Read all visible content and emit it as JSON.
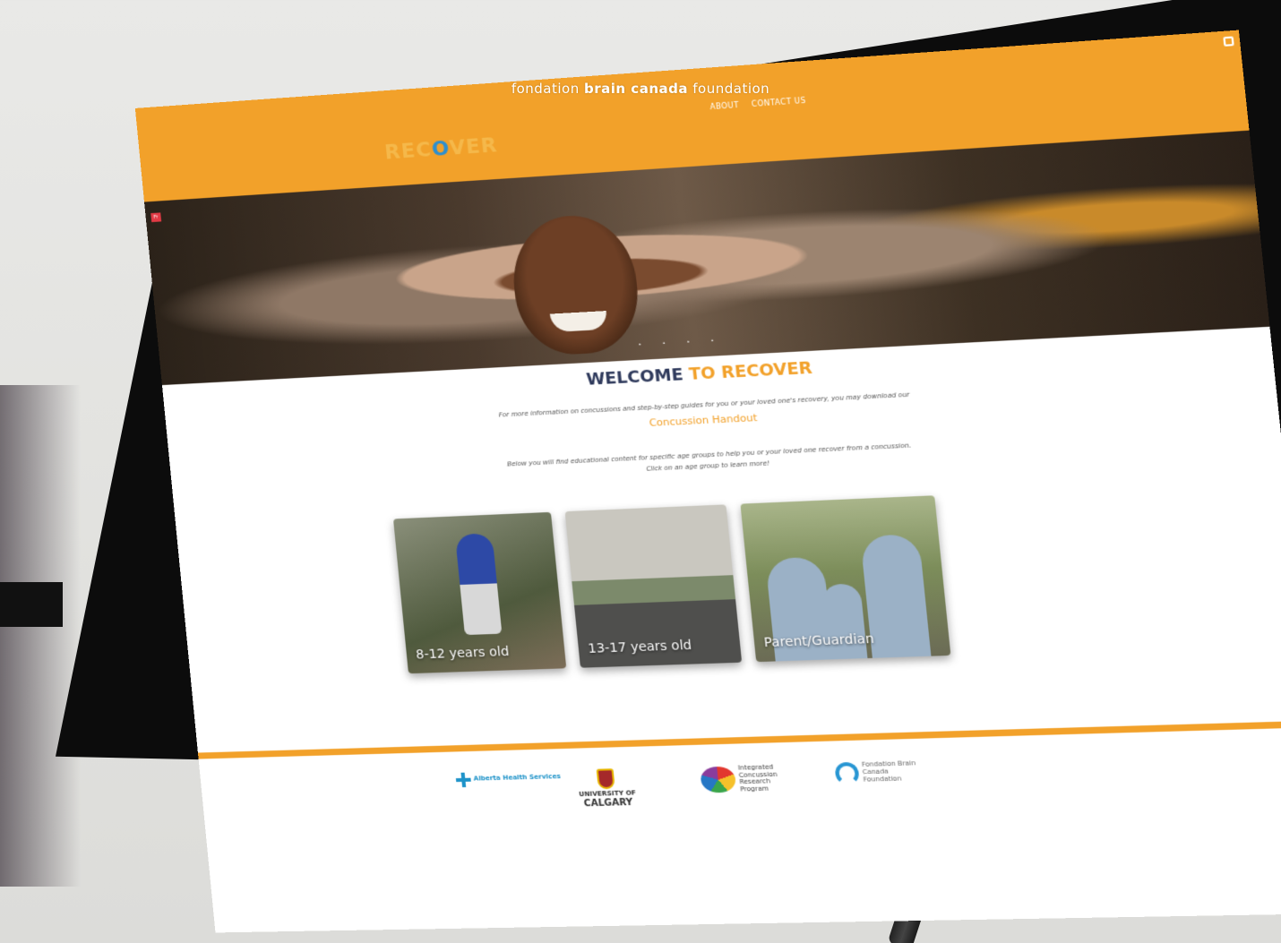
{
  "caption": {
    "prefix": "fondation ",
    "bold": "brain canada",
    "suffix": " foundation"
  },
  "site": {
    "logo_pre": "REC",
    "logo_o": "O",
    "logo_post": "VER",
    "nav": [
      "ABOUT",
      "CONTACT US"
    ],
    "lang_badge": "Fr",
    "welcome_main": "WELCOME ",
    "welcome_accent": "TO RECOVER",
    "para1": "For more information on concussions and step-by-step guides for you or your loved one's recovery, you may download our",
    "handout_link": "Concussion Handout",
    "para2": "Below you will find educational content for specific age groups to help you or your loved one recover from a concussion.",
    "para3": "Click on an age group to learn more!",
    "cards": [
      "8-12 years old",
      "13-17 years old",
      "Parent/Guardian"
    ],
    "slider_dots": "• • • •"
  },
  "partners": {
    "ahs": "Alberta Health Services",
    "ucal_top": "UNIVERSITY OF",
    "ucal_bottom": "CALGARY",
    "iconcussion": "Integrated Concussion Research Program",
    "brain_canada": "Fondation Brain Canada Foundation"
  },
  "colors": {
    "accent": "#f2a12a",
    "navy": "#2f3a5c",
    "blue": "#2896d3"
  }
}
